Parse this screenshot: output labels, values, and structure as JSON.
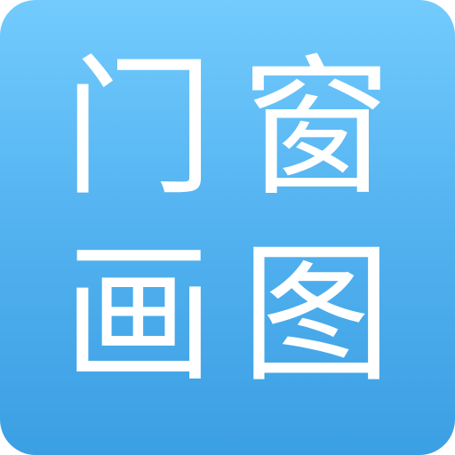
{
  "icon": {
    "colors": {
      "gradient_top": "#73cbfd",
      "gradient_bottom": "#3b9fe3",
      "glyph": "#ffffff"
    },
    "characters": [
      "门",
      "窗",
      "画",
      "图"
    ]
  }
}
